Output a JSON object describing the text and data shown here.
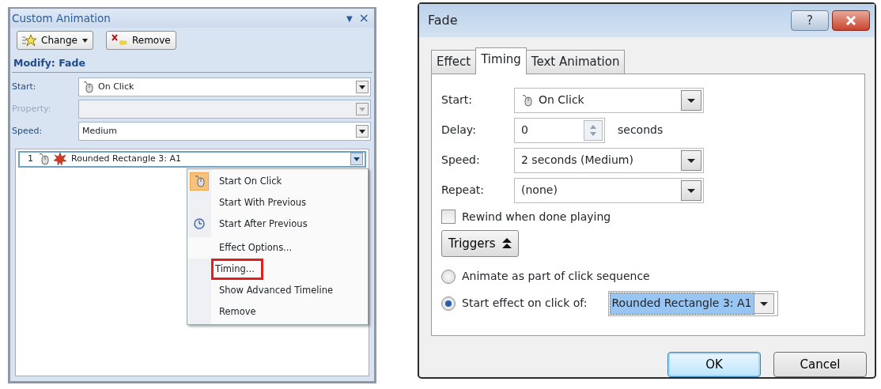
{
  "task_pane": {
    "title": "Custom Animation",
    "menu_glyph": "▼",
    "close_glyph": "×",
    "buttons": [
      {
        "label": "Change",
        "kind": "dropdown"
      },
      {
        "label": "Remove",
        "kind": "remove"
      }
    ],
    "section": "Modify: Fade",
    "fields": [
      {
        "kind": "mouse",
        "label": "Start:",
        "value": "On Click",
        "disabled": false
      },
      {
        "kind": "plain",
        "label": "Property:",
        "disabled": true
      },
      {
        "kind": "plain",
        "label": "Speed:",
        "value": "Medium",
        "disabled": false
      }
    ],
    "list_items": [
      {
        "number": "1",
        "text": "Rounded Rectangle 3: A1",
        "selected": true
      }
    ],
    "context_menu": [
      {
        "kind": "mouse",
        "label": "Start On Click",
        "selected": true,
        "separator_before": false,
        "outlined": false
      },
      {
        "kind": "plain",
        "label": "Start With Previous",
        "selected": false,
        "separator_before": false,
        "outlined": false
      },
      {
        "kind": "clock",
        "label": "Start After Previous",
        "selected": false,
        "separator_before": false,
        "outlined": false
      },
      {
        "kind": "plain",
        "label": "Effect Options...",
        "selected": false,
        "separator_before": true,
        "outlined": false
      },
      {
        "kind": "plain",
        "label": "Timing...",
        "selected": false,
        "separator_before": false,
        "outlined": true
      },
      {
        "kind": "plain",
        "label": "Show Advanced Timeline",
        "selected": false,
        "separator_before": false,
        "outlined": false
      },
      {
        "kind": "plain",
        "label": "Remove",
        "selected": false,
        "separator_before": false,
        "outlined": false
      }
    ]
  },
  "dialog": {
    "title": "Fade",
    "help_glyph": "?",
    "tabs": [
      {
        "label": "Effect",
        "selected": false
      },
      {
        "label": "Timing",
        "selected": true
      },
      {
        "label": "Text Animation",
        "selected": false
      }
    ],
    "fields": [
      {
        "kind": "select",
        "label": "Start:",
        "value": "On Click"
      },
      {
        "kind": "spinner",
        "label": "Delay:",
        "value": "0",
        "unit": "seconds"
      },
      {
        "kind": "select",
        "label": "Speed:",
        "value": "2 seconds (Medium)"
      },
      {
        "kind": "select",
        "label": "Repeat:",
        "value": "(none)"
      }
    ],
    "rewind": {
      "label": "Rewind when done playing",
      "checked": false
    },
    "triggers_button": {
      "label": "Triggers",
      "expanded": true
    },
    "radios": [
      {
        "label": "Animate as part of click sequence",
        "selected": false
      },
      {
        "label": "Start effect on click of:",
        "selected": true
      }
    ],
    "trigger_select": {
      "value": "Rounded Rectangle 3: A1",
      "highlighted": true
    },
    "buttons": [
      {
        "label": "OK",
        "default": true
      },
      {
        "label": "Cancel",
        "default": false
      }
    ]
  }
}
